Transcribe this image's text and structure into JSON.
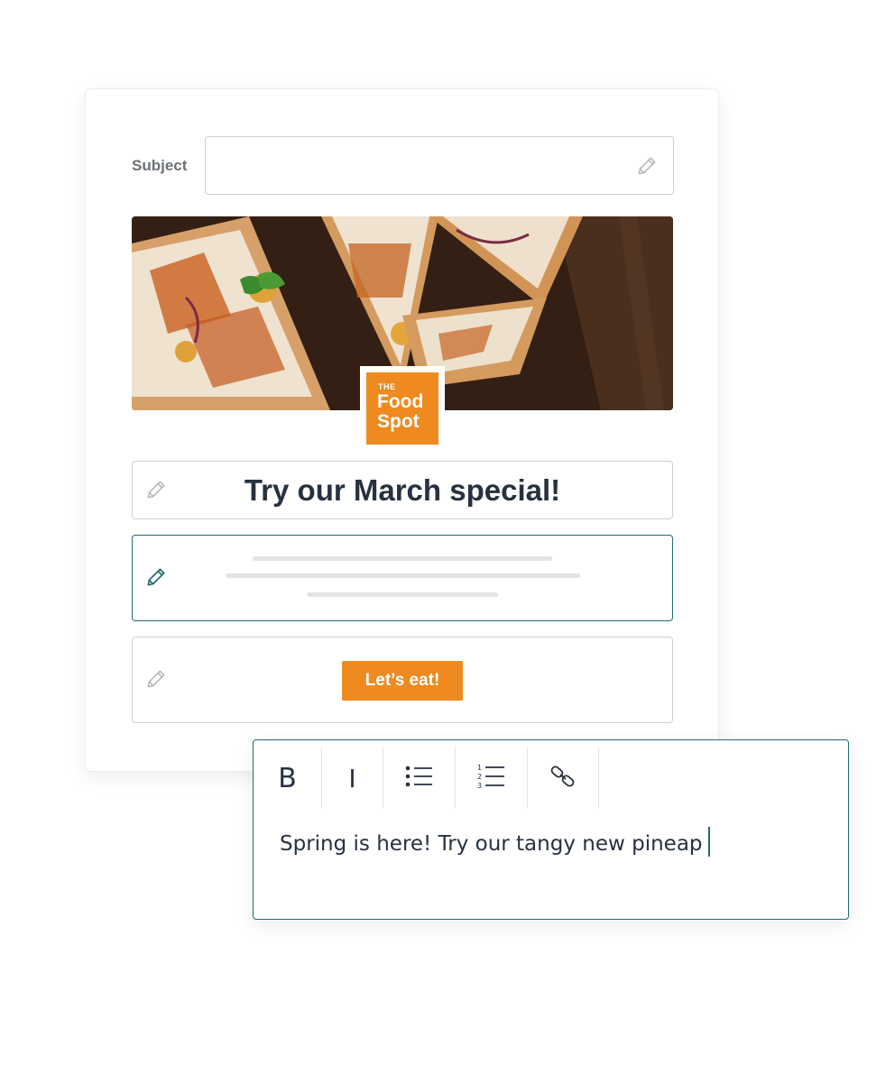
{
  "subject": {
    "label": "Subject",
    "value": ""
  },
  "logo": {
    "line1": "THE",
    "line2": "Food",
    "line3": "Spot"
  },
  "headline": {
    "text": "Try our March special!"
  },
  "cta": {
    "label": "Let’s eat!"
  },
  "toolbar": {
    "bold_label": "B",
    "italic_label": "I",
    "bullet_icon": "bulleted-list-icon",
    "numbered_icon": "numbered-list-icon",
    "link_icon": "link-icon"
  },
  "editor": {
    "text": "Spring is here! Try our tangy new pineap"
  },
  "icons": {
    "edit": "pencil-icon"
  },
  "colors": {
    "accent": "#1f6e6c",
    "brand": "#ee8a1f",
    "text": "#273140",
    "border": "#cfcfcf"
  }
}
